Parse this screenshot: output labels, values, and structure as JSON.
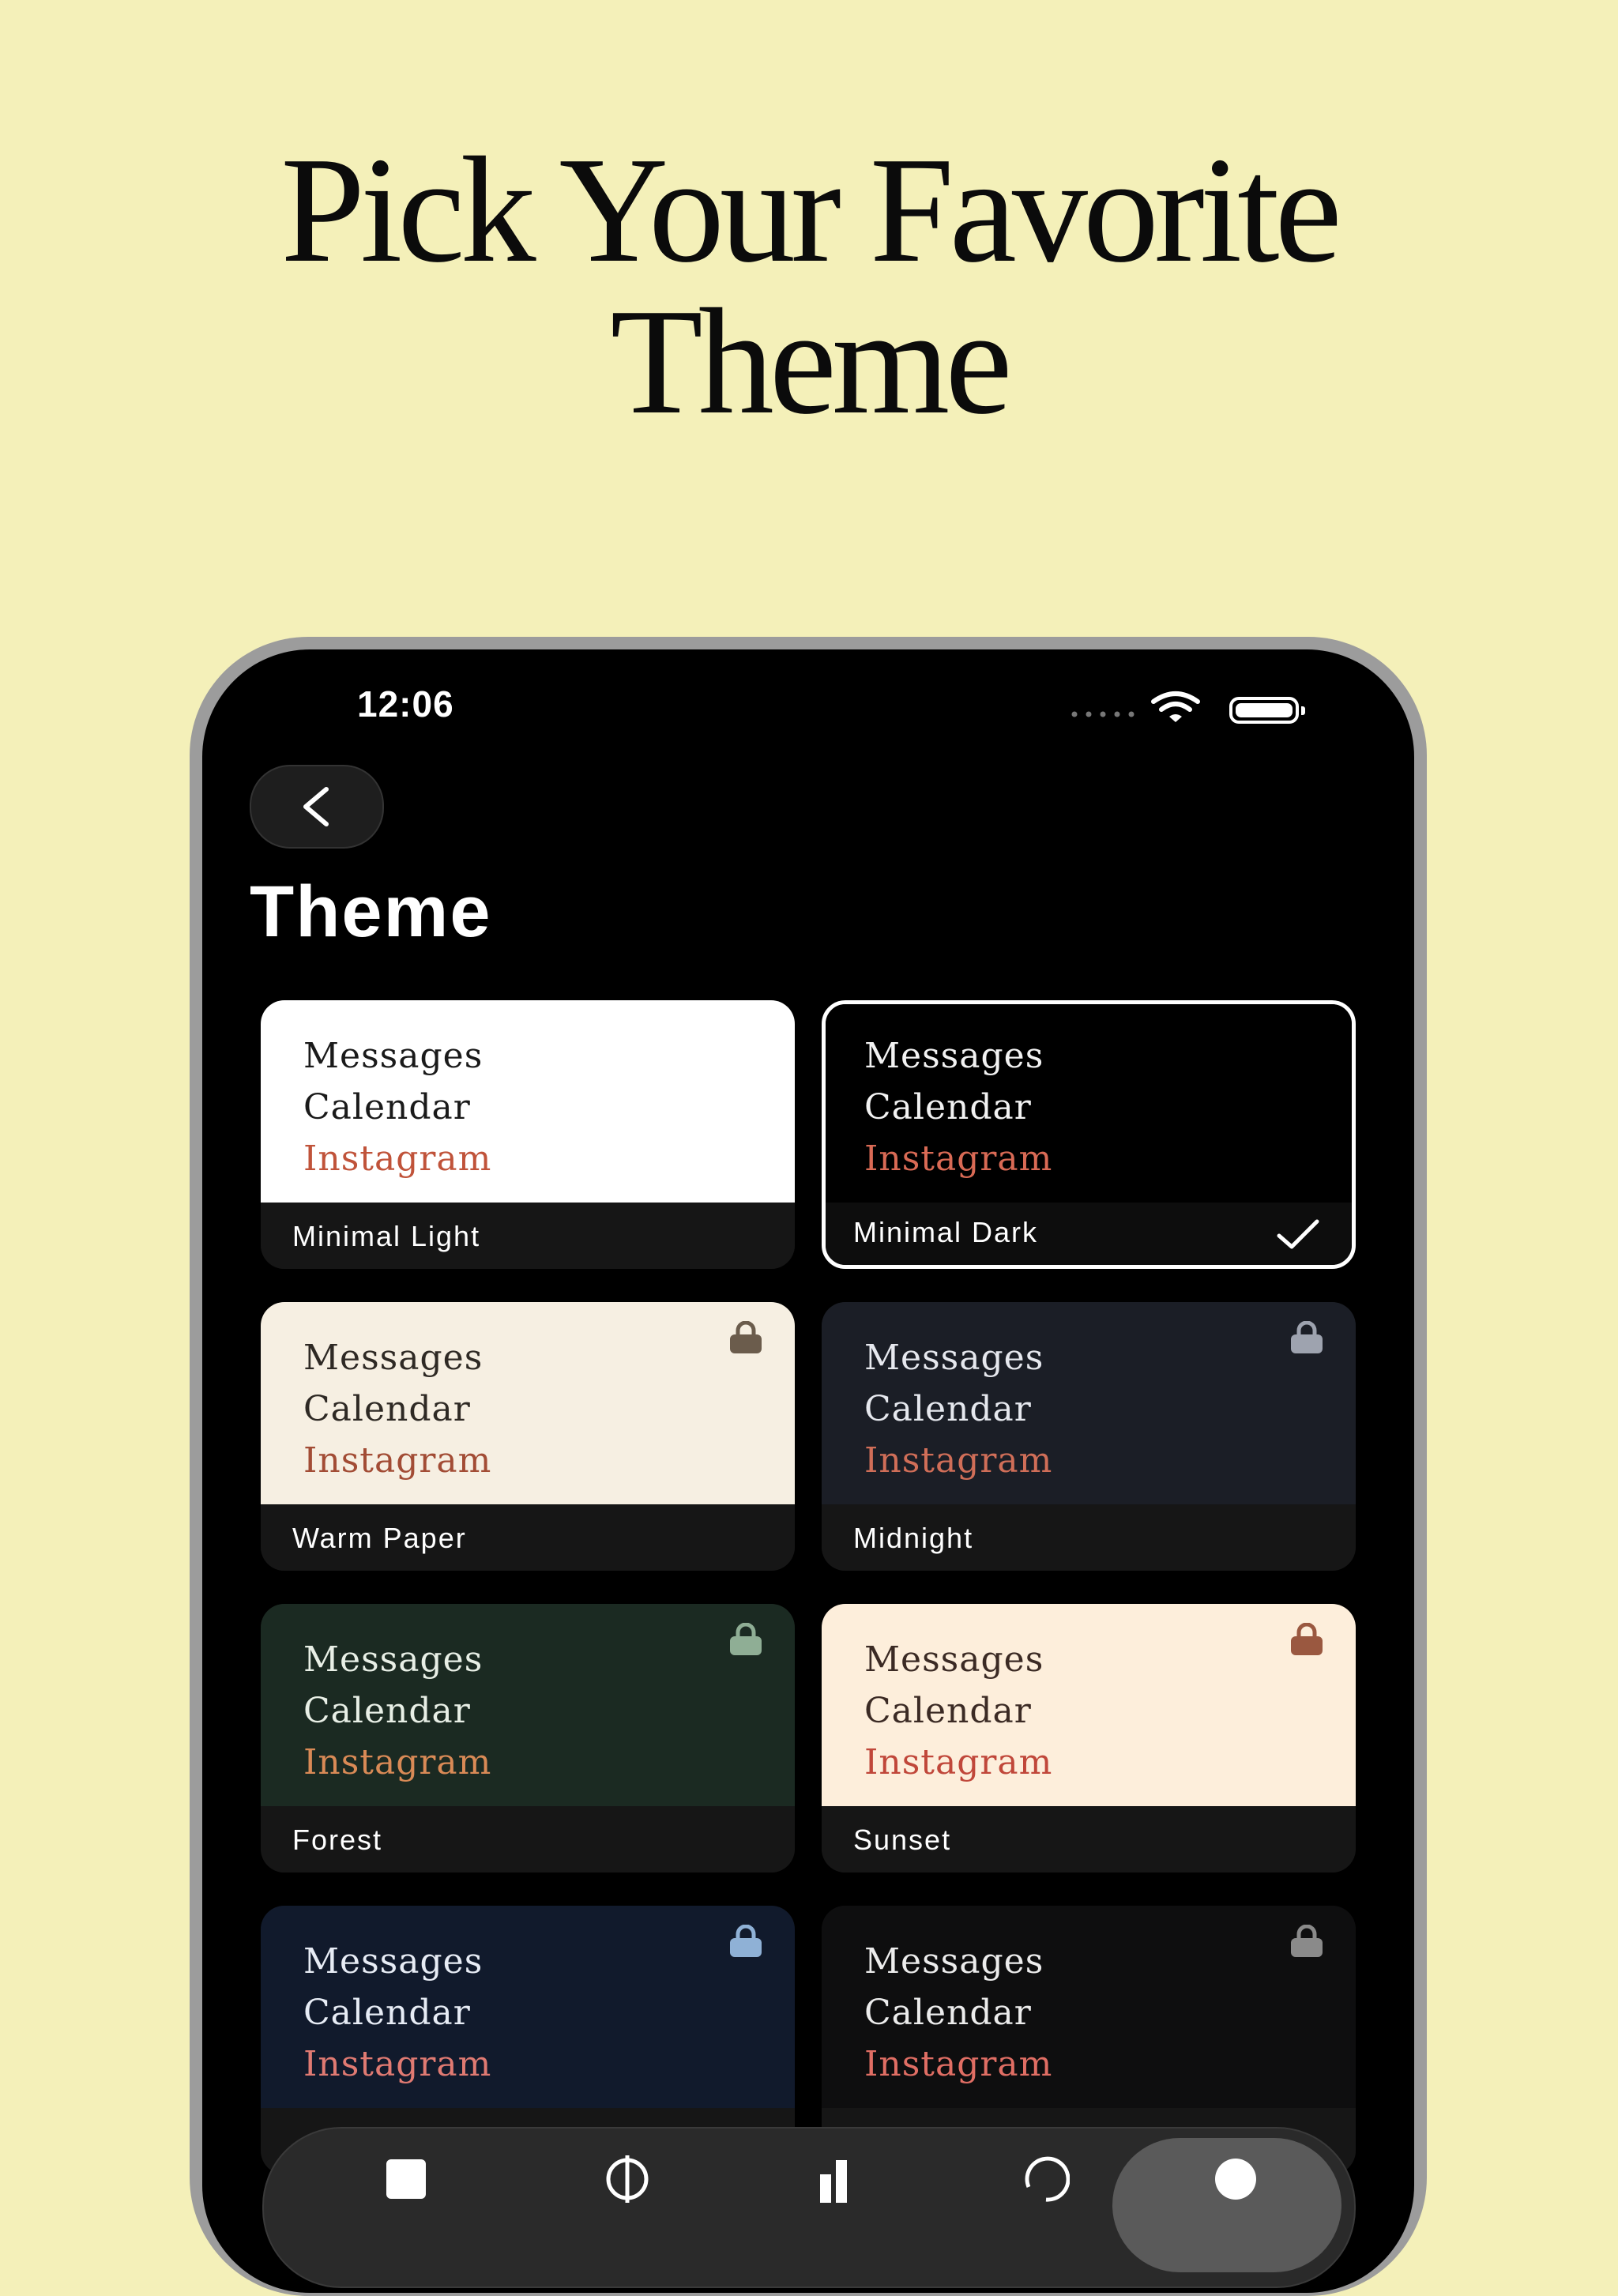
{
  "headline": {
    "line1": "Pick Your Favorite",
    "line2": "Theme"
  },
  "status_bar": {
    "time": "12:06"
  },
  "header": {
    "back_icon": "chevron-left-icon",
    "title": "Theme"
  },
  "preview_lines": {
    "line1": "Messages",
    "line2": "Calendar",
    "line3": "Instagram"
  },
  "themes": [
    {
      "name": "Minimal Light",
      "bg": "#ffffff",
      "text": "#1a1a1a",
      "accent": "#c0533a",
      "selected": false,
      "locked": false
    },
    {
      "name": "Minimal Dark",
      "bg": "#000000",
      "text": "#f2f2f2",
      "accent": "#d96a55",
      "selected": true,
      "locked": false
    },
    {
      "name": "Warm Paper",
      "bg": "#f6efe2",
      "text": "#2e2924",
      "accent": "#a24c35",
      "selected": false,
      "locked": true,
      "lock_color": "#6b5c4c"
    },
    {
      "name": "Midnight",
      "bg": "#1b1e26",
      "text": "#e6e8ee",
      "accent": "#d06e58",
      "selected": false,
      "locked": true,
      "lock_color": "#9ea3af"
    },
    {
      "name": "Forest",
      "bg": "#1b2a22",
      "text": "#e8efe6",
      "accent": "#d98a56",
      "selected": false,
      "locked": true,
      "lock_color": "#8fae95"
    },
    {
      "name": "Sunset",
      "bg": "#fdeedb",
      "text": "#3b2a24",
      "accent": "#c0473a",
      "selected": false,
      "locked": true,
      "lock_color": "#9a5840"
    },
    {
      "name": "",
      "bg": "#111a2c",
      "text": "#e7ecf5",
      "accent": "#e07a72",
      "selected": false,
      "locked": true,
      "lock_color": "#8fb1d6"
    },
    {
      "name": "",
      "bg": "#0e0e0f",
      "text": "#ececec",
      "accent": "#e06e64",
      "selected": false,
      "locked": true,
      "lock_color": "#8a8a8a"
    }
  ],
  "tab_bar": {
    "icons": [
      "list-icon",
      "target-icon",
      "stats-icon",
      "history-icon",
      "settings-icon"
    ]
  }
}
